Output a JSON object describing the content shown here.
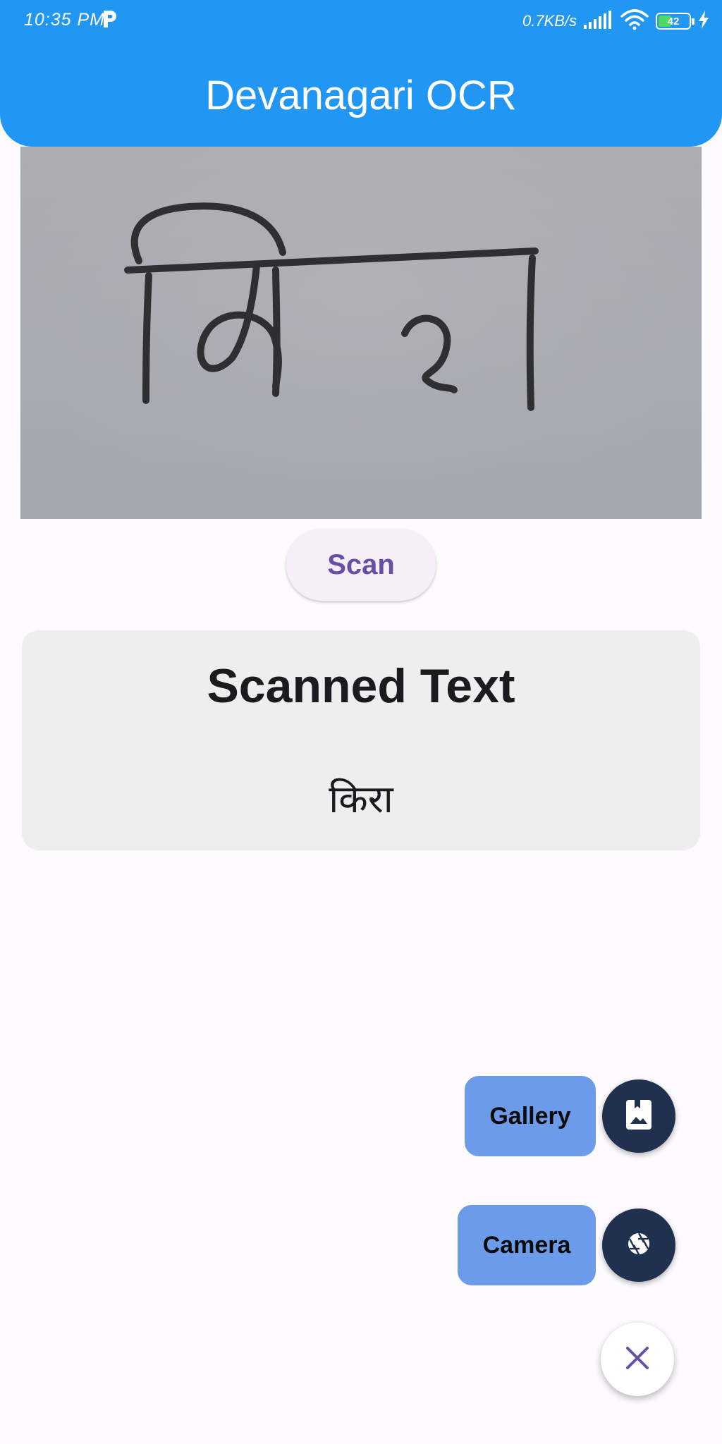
{
  "status_bar": {
    "time": "10:35 PM",
    "notification_icon": "p-icon",
    "network_speed": "0.7KB/s",
    "signal_icon": "signal-icon",
    "wifi_icon": "wifi-icon",
    "battery_level": "42",
    "battery_fraction": 0.42,
    "charging_icon": "charging-bolt-icon"
  },
  "app_bar": {
    "title": "Devanagari OCR",
    "color": "#2196f3"
  },
  "image_preview": {
    "handwritten_text": "किरा"
  },
  "scan_button": {
    "label": "Scan",
    "color": "#6750a4"
  },
  "result": {
    "heading": "Scanned Text",
    "text": "किरा"
  },
  "speed_dial": {
    "gallery": {
      "label": "Gallery",
      "icon": "gallery-photo-icon"
    },
    "camera": {
      "label": "Camera",
      "icon": "camera-shutter-icon"
    },
    "close": {
      "icon": "close-icon"
    },
    "label_color": "#6c9ce9",
    "button_color": "#203150",
    "close_icon_color": "#6750a4"
  }
}
